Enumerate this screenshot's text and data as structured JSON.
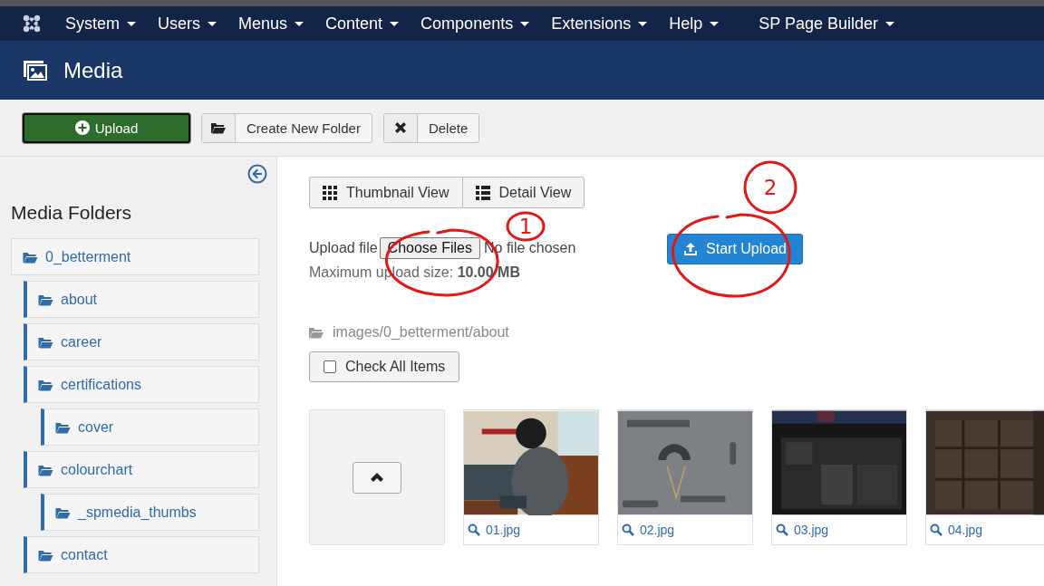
{
  "navbar": {
    "menus": [
      {
        "label": "System"
      },
      {
        "label": "Users"
      },
      {
        "label": "Menus"
      },
      {
        "label": "Content"
      },
      {
        "label": "Components"
      },
      {
        "label": "Extensions"
      },
      {
        "label": "Help"
      },
      {
        "label": "SP Page Builder"
      }
    ]
  },
  "header": {
    "title": "Media"
  },
  "toolbar": {
    "buttons": [
      {
        "label": "Upload",
        "kind": "upload"
      },
      {
        "label": "Create New Folder",
        "kind": "folder"
      },
      {
        "label": "Delete",
        "kind": "delete"
      }
    ]
  },
  "sidebar": {
    "title": "Media Folders",
    "folders": [
      {
        "label": "0_betterment",
        "children": [
          {
            "label": "about"
          },
          {
            "label": "career"
          },
          {
            "label": "certifications",
            "children": [
              {
                "label": "cover"
              }
            ]
          },
          {
            "label": "colourchart",
            "children": [
              {
                "label": "_spmedia_thumbs"
              }
            ]
          },
          {
            "label": "contact"
          }
        ]
      }
    ]
  },
  "views": [
    {
      "label": "Thumbnail View",
      "kind": "grid"
    },
    {
      "label": "Detail View",
      "kind": "list"
    }
  ],
  "upload": {
    "label": "Upload file",
    "choose": "Choose Files",
    "status": "No file chosen",
    "limit": "Maximum upload size: **10.00 MB**",
    "submit": "Start Upload"
  },
  "path": "images/0_betterment/about",
  "check_all": {
    "label": "Check All Items",
    "checked": false
  },
  "items": [
    {
      "kind": "up"
    },
    {
      "kind": "picture",
      "name": "01.jpg"
    },
    {
      "kind": "picture",
      "name": "02.jpg"
    },
    {
      "kind": "picture",
      "name": "03.jpg"
    },
    {
      "kind": "picture",
      "name": "04.jpg"
    }
  ],
  "annotations": [
    {
      "kind": "ellipse"
    },
    {
      "kind": "circled-number",
      "label": "1"
    },
    {
      "kind": "circled-number",
      "label": "2"
    },
    {
      "kind": "ellipse"
    }
  ]
}
